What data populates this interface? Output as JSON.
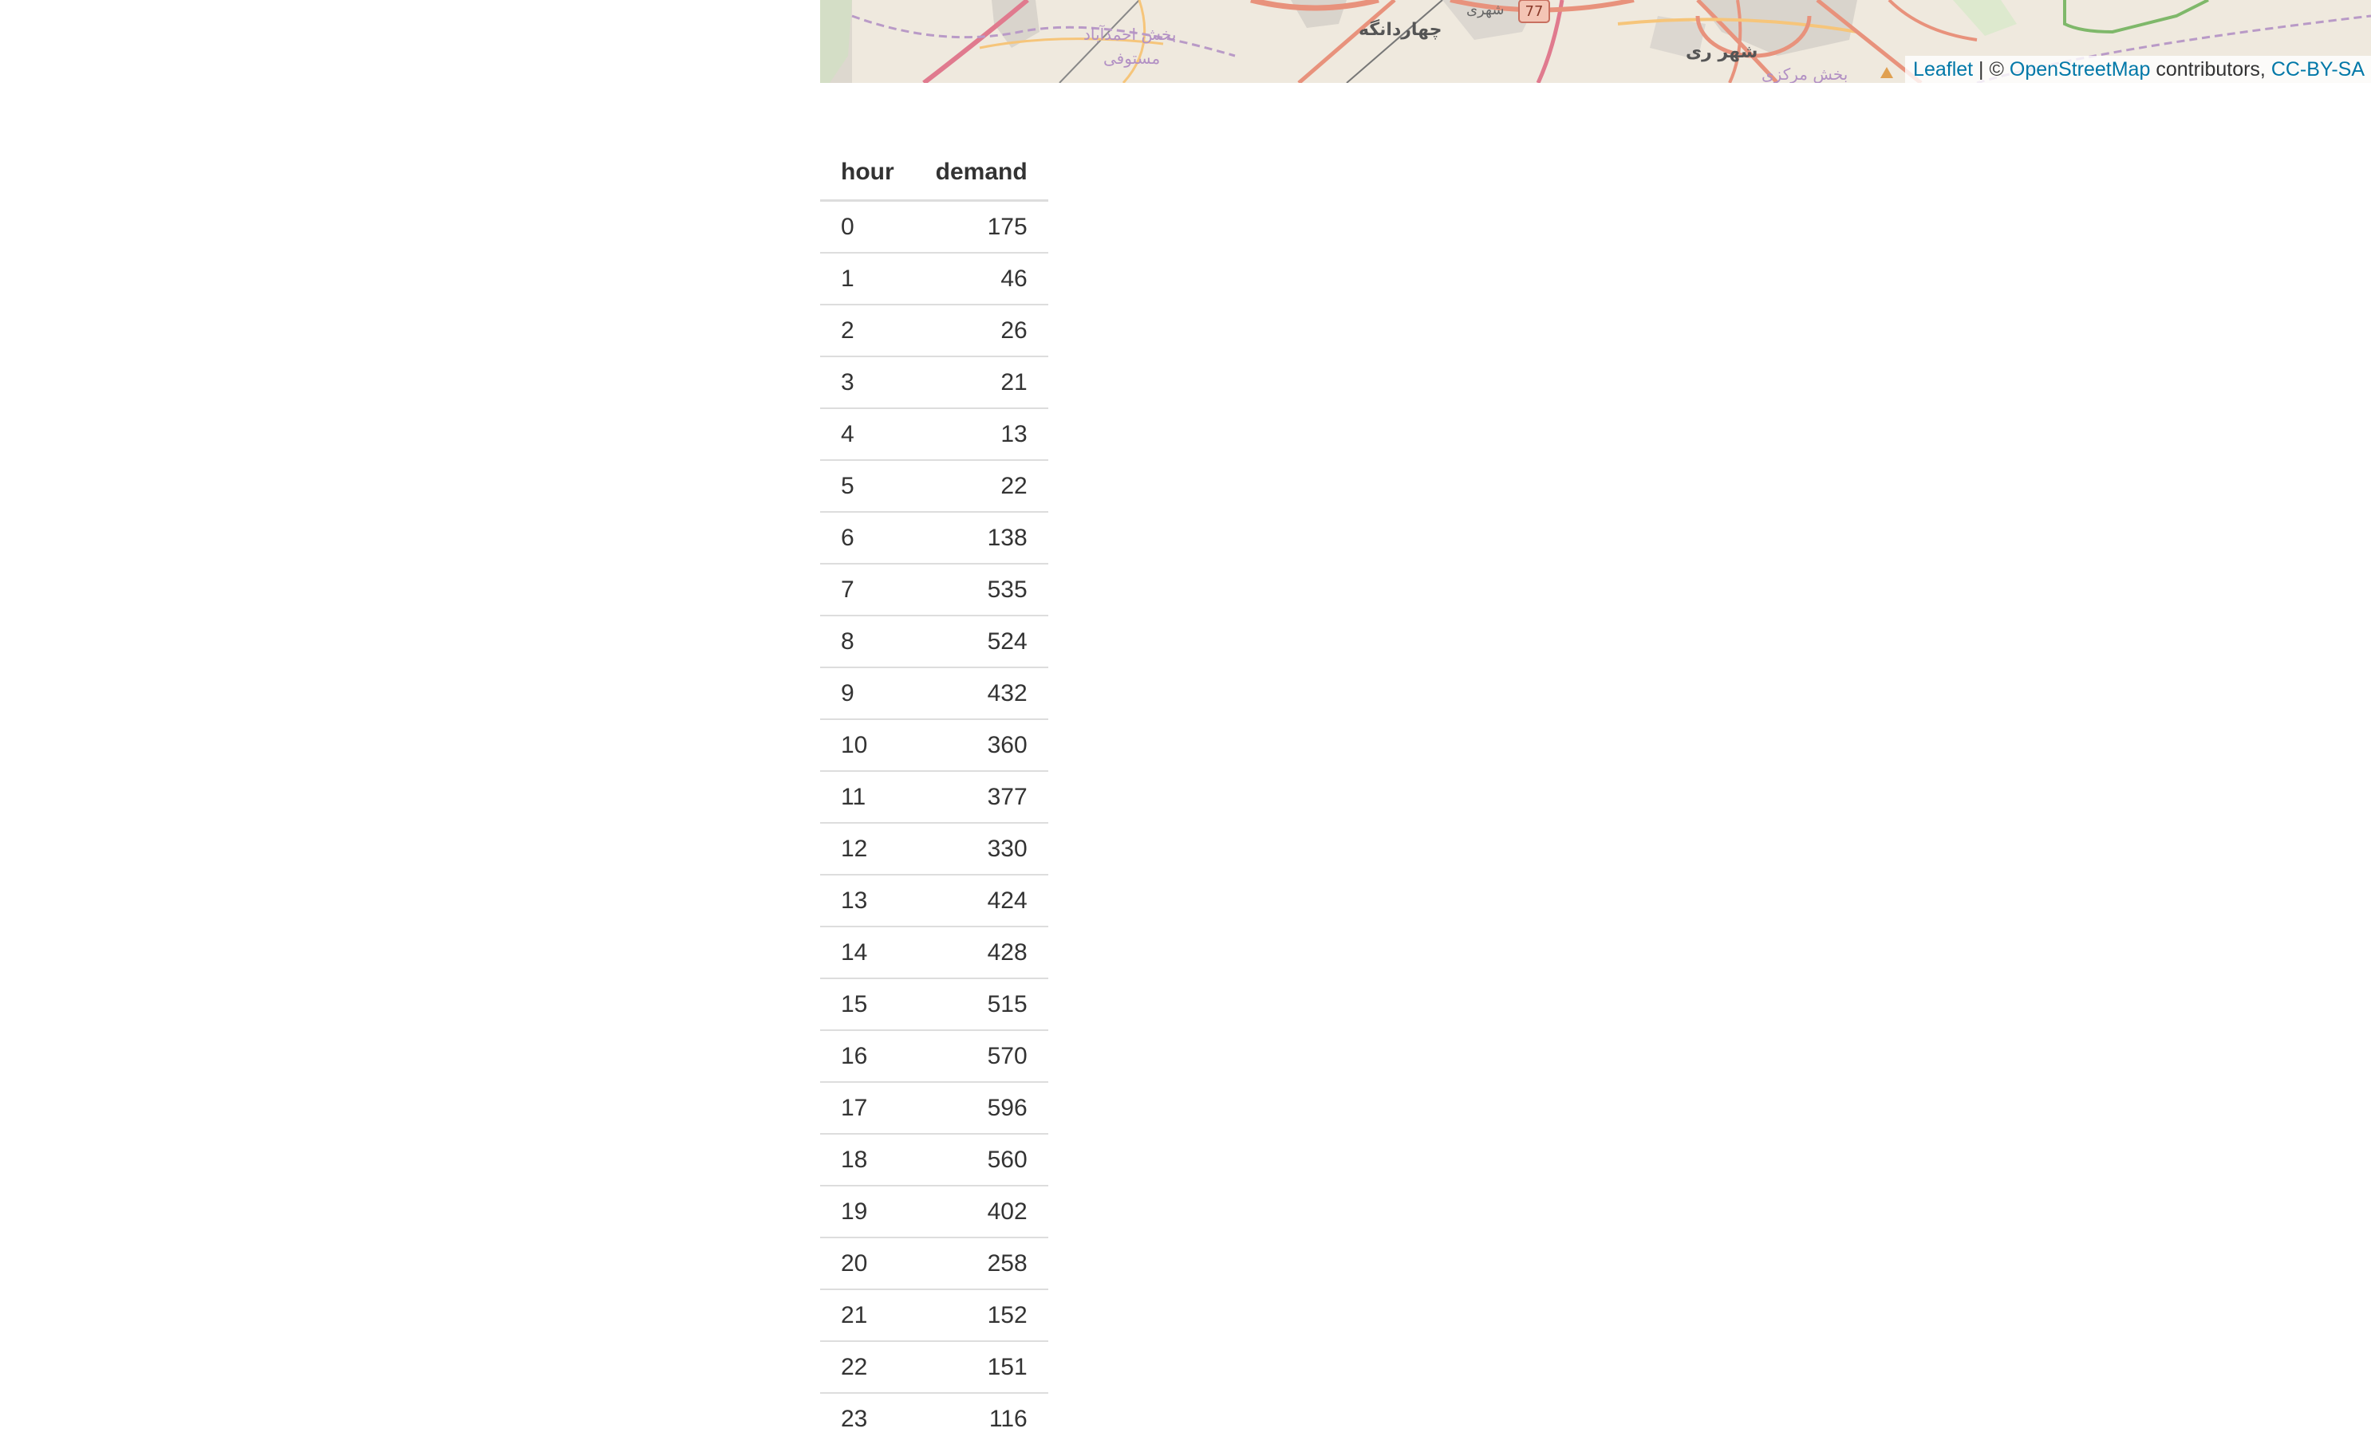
{
  "map": {
    "labels": [
      {
        "text": "بخش احمدآباد",
        "kind": "district"
      },
      {
        "text": "مستوفی",
        "kind": "district"
      },
      {
        "text": "چهاردانگه",
        "kind": "town"
      },
      {
        "text": "شهری",
        "kind": "town"
      },
      {
        "text": "77",
        "kind": "road-shield"
      },
      {
        "text": "شهر ری",
        "kind": "town"
      },
      {
        "text": "بخش مرکزی",
        "kind": "district"
      }
    ],
    "attribution": {
      "leaflet_link": "Leaflet",
      "separator": " | © ",
      "osm_link": "OpenStreetMap",
      "contributors_text": " contributors, ",
      "license_link": "CC-BY-SA"
    },
    "colors": {
      "link": "#0078a8",
      "land": "#efe9de",
      "major_road": "#e8927c",
      "motorway": "#e07a8e",
      "secondary_road": "#f6c57a",
      "boundary": "#b99ac7",
      "green_boundary": "#7fb86a"
    }
  },
  "table": {
    "headers": {
      "hour": "hour",
      "demand": "demand"
    },
    "rows": [
      {
        "hour": "0",
        "demand": "175"
      },
      {
        "hour": "1",
        "demand": "46"
      },
      {
        "hour": "2",
        "demand": "26"
      },
      {
        "hour": "3",
        "demand": "21"
      },
      {
        "hour": "4",
        "demand": "13"
      },
      {
        "hour": "5",
        "demand": "22"
      },
      {
        "hour": "6",
        "demand": "138"
      },
      {
        "hour": "7",
        "demand": "535"
      },
      {
        "hour": "8",
        "demand": "524"
      },
      {
        "hour": "9",
        "demand": "432"
      },
      {
        "hour": "10",
        "demand": "360"
      },
      {
        "hour": "11",
        "demand": "377"
      },
      {
        "hour": "12",
        "demand": "330"
      },
      {
        "hour": "13",
        "demand": "424"
      },
      {
        "hour": "14",
        "demand": "428"
      },
      {
        "hour": "15",
        "demand": "515"
      },
      {
        "hour": "16",
        "demand": "570"
      },
      {
        "hour": "17",
        "demand": "596"
      },
      {
        "hour": "18",
        "demand": "560"
      },
      {
        "hour": "19",
        "demand": "402"
      },
      {
        "hour": "20",
        "demand": "258"
      },
      {
        "hour": "21",
        "demand": "152"
      },
      {
        "hour": "22",
        "demand": "151"
      },
      {
        "hour": "23",
        "demand": "116"
      }
    ]
  }
}
